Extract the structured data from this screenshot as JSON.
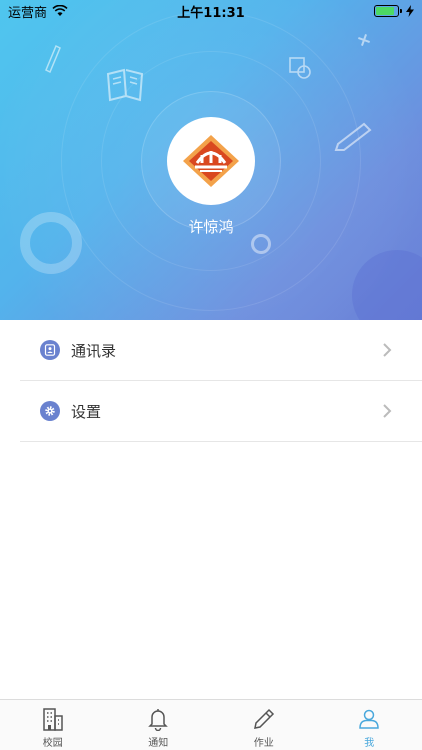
{
  "status_bar": {
    "carrier": "运营商",
    "time": "上午11:31",
    "battery_level": 0.85
  },
  "profile": {
    "name": "许惊鸿"
  },
  "menu": [
    {
      "label": "通讯录",
      "icon": "contacts-icon"
    },
    {
      "label": "设置",
      "icon": "settings-gear-icon"
    }
  ],
  "tab_bar": {
    "tabs": [
      {
        "label": "校园",
        "icon": "building-icon"
      },
      {
        "label": "通知",
        "icon": "bell-icon"
      },
      {
        "label": "作业",
        "icon": "pencil-icon"
      },
      {
        "label": "我",
        "icon": "person-icon"
      }
    ],
    "active_index": 3
  },
  "colors": {
    "header_gradient_start": "#4fc6ee",
    "header_gradient_end": "#6a7fd6",
    "menu_icon": "#6a82cf",
    "active_tab": "#4aa8dc",
    "battery": "#4cd964"
  }
}
